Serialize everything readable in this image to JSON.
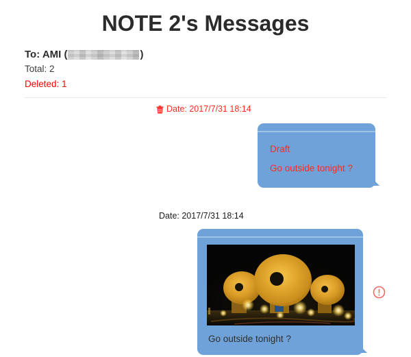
{
  "page": {
    "title": "NOTE 2's Messages"
  },
  "header": {
    "to_prefix": "To: AMI (",
    "to_suffix": ")",
    "redacted_label": "redacted-phone-number",
    "total_label": "Total: 2",
    "deleted_label": "Deleted: 1"
  },
  "messages": [
    {
      "deleted": true,
      "trash_icon": "trash-icon",
      "date": "Date: 2017/7/31 18:14",
      "status_label": "Draft",
      "body": "Go outside tonight ?",
      "bubble_color": "#6fa2d8",
      "text_color": "#ff2a1f"
    },
    {
      "deleted": false,
      "date": "Date: 2017/7/31 18:14",
      "body": "Go outside tonight ?",
      "attachment": "night-photo-golden-domes",
      "error_icon": "exclamation-circle-icon",
      "bubble_color": "#6fa2d8",
      "text_color": "#2f2f2f",
      "error_color": "#f0685f"
    }
  ],
  "colors": {
    "deleted_red": "#ff0000",
    "bubble_blue": "#6fa2d8",
    "bubble_highlight": "#9cc2e6",
    "divider": "#e8e8e8"
  }
}
